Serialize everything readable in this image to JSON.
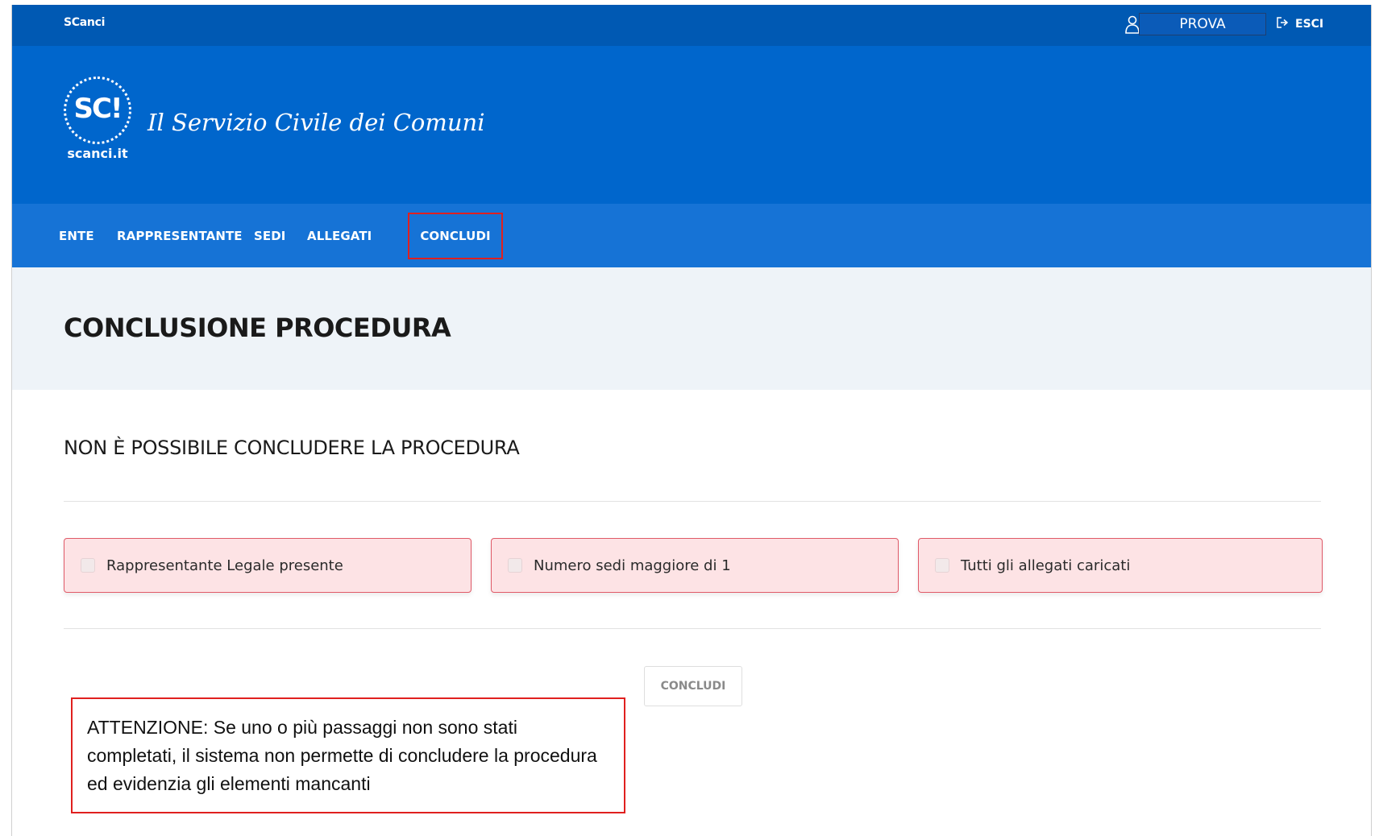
{
  "topbar": {
    "brand": "SCanci",
    "user_name": "PROVA",
    "logout_label": "ESCI"
  },
  "header": {
    "logo_mark": "SC!",
    "logo_caption": "scanci.it",
    "site_title": "Il Servizio Civile dei Comuni"
  },
  "nav": {
    "items": [
      {
        "label": "ENTE"
      },
      {
        "label": "RAPPRESENTANTE"
      },
      {
        "label": "SEDI"
      },
      {
        "label": "ALLEGATI"
      },
      {
        "label": "CONCLUDI",
        "active": true
      }
    ]
  },
  "page": {
    "title": "CONCLUSIONE PROCEDURA",
    "subtitle": "NON È POSSIBILE CONCLUDERE LA PROCEDURA",
    "checks": [
      {
        "label": "Rappresentante Legale presente",
        "checked": false
      },
      {
        "label": "Numero sedi maggiore di 1",
        "checked": false
      },
      {
        "label": "Tutti gli allegati caricati",
        "checked": false
      }
    ],
    "submit_label": "CONCLUDI",
    "notice": "ATTENZIONE: Se uno o più passaggi non sono stati completati, il sistema non permette di concludere la procedura ed evidenzia gli elementi mancanti"
  },
  "colors": {
    "topbar": "#0059b3",
    "header": "#0066cc",
    "nav": "#1673d6",
    "error_bg": "#fde3e5",
    "error_border": "#e05a68",
    "highlight": "#e0201f"
  }
}
